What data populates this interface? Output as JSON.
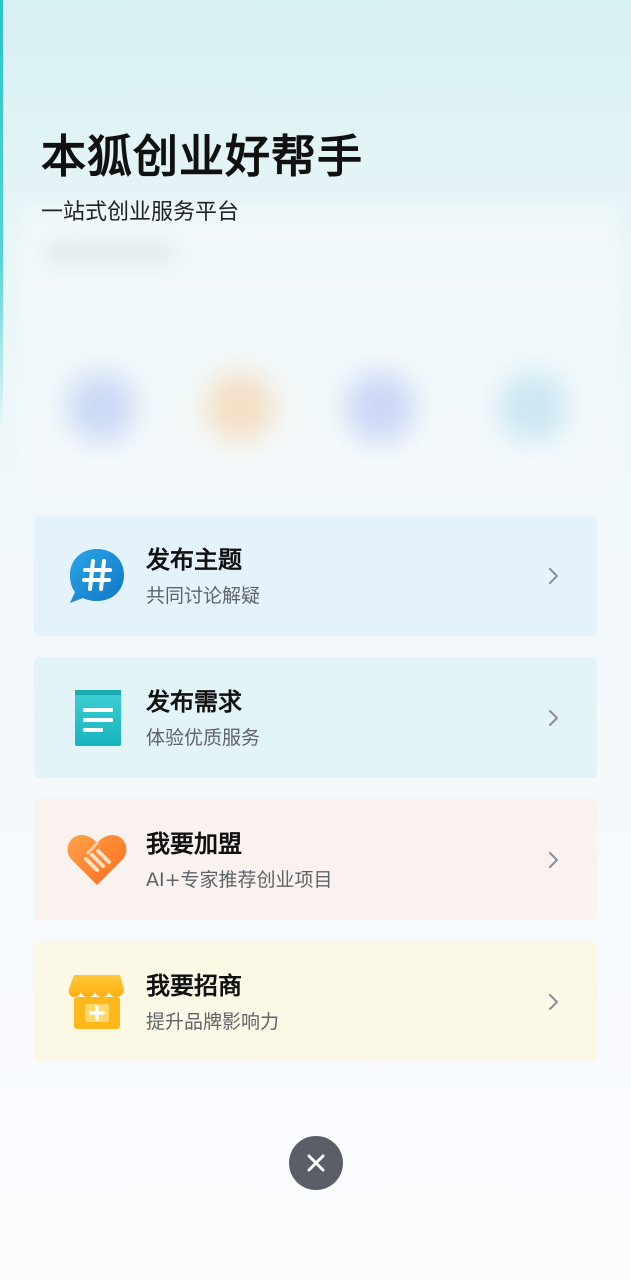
{
  "header": {
    "title": "本狐创业好帮手",
    "subtitle": "一站式创业服务平台"
  },
  "cards": [
    {
      "title": "发布主题",
      "desc": "共同讨论解疑",
      "bg": "#e3f2fb",
      "icon": "hashtag-chat-bubble-icon"
    },
    {
      "title": "发布需求",
      "desc": "体验优质服务",
      "bg": "#e2f4f8",
      "icon": "document-list-icon"
    },
    {
      "title": "我要加盟",
      "desc": "AI+专家推荐创业项目",
      "bg": "#f9f2ee",
      "icon": "handshake-heart-icon"
    },
    {
      "title": "我要招商",
      "desc": "提升品牌影响力",
      "bg": "#fcf8e6",
      "icon": "storefront-add-icon"
    }
  ],
  "colors": {
    "accent_teal": "#2cc4c8",
    "close_button": "#5a5e67",
    "hashtag_blue": "#1a8fd6",
    "heart_orange": "#ff8a2b",
    "store_yellow": "#ffb81c"
  },
  "close": {
    "icon": "close-icon"
  }
}
